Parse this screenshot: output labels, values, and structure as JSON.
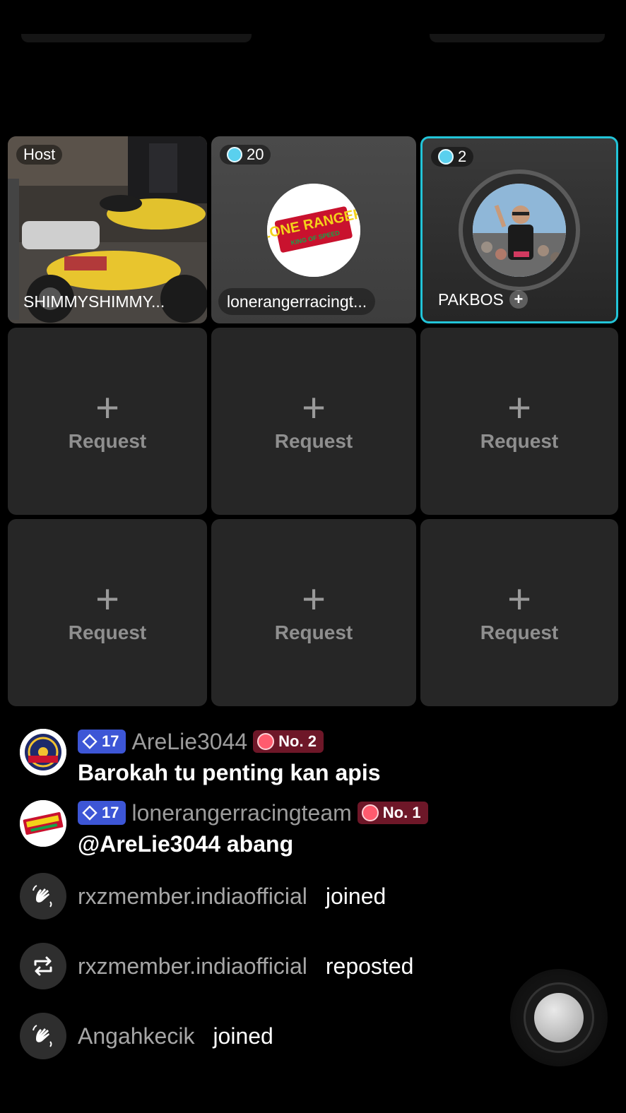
{
  "grid": {
    "host": {
      "badge": "Host",
      "name": "SHIMMYSHIMMY..."
    },
    "guests": [
      {
        "count": "20",
        "name": "lonerangerracingt...",
        "logo_text": "LONE RANGER",
        "logo_sub": "KING OF SPEED"
      },
      {
        "count": "2",
        "name": "PAKBOS"
      }
    ],
    "request_slots": [
      {
        "label": "Request"
      },
      {
        "label": "Request"
      },
      {
        "label": "Request"
      },
      {
        "label": "Request"
      },
      {
        "label": "Request"
      },
      {
        "label": "Request"
      }
    ]
  },
  "chat": {
    "messages": [
      {
        "level": "17",
        "username": "AreLie3044",
        "rank": "No. 2",
        "text": "Barokah tu penting kan apis"
      },
      {
        "level": "17",
        "username": "lonerangerracingteam",
        "rank": "No. 1",
        "text": "@AreLie3044 abang"
      }
    ],
    "events": [
      {
        "icon": "wave-hand-icon",
        "user": "rxzmember.indiaofficial",
        "action": "joined"
      },
      {
        "icon": "repost-icon",
        "user": "rxzmember.indiaofficial",
        "action": "reposted"
      },
      {
        "icon": "wave-hand-icon",
        "user": "Angahkecik",
        "action": "joined"
      }
    ]
  },
  "colors": {
    "active_border": "#22c4d8",
    "level_badge": "#3d56d6",
    "rank_badge": "#6e1728"
  }
}
